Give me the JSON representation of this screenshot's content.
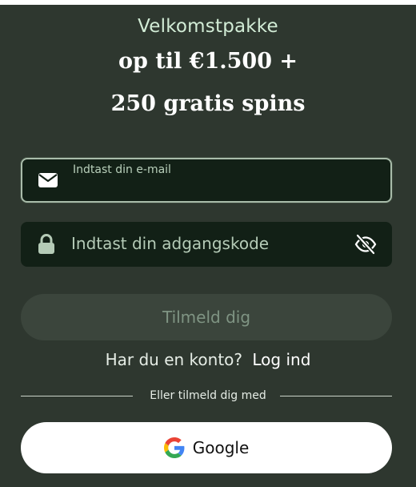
{
  "promo": {
    "subtitle": "Velkomstpakke",
    "headline_line1": "op til €1.500 +",
    "headline_line2": "250 gratis spins"
  },
  "form": {
    "email": {
      "label": "Indtast din e-mail",
      "value": "",
      "icon": "envelope-icon"
    },
    "password": {
      "placeholder": "Indtast din adgangskode",
      "value": "",
      "icon": "lock-icon",
      "toggle_icon": "eye-slash-icon"
    },
    "signup_label": "Tilmeld dig"
  },
  "login": {
    "prompt": "Har du en konto?",
    "link_label": "Log ind"
  },
  "social": {
    "divider_text": "Eller tilmeld dig med",
    "google_label": "Google",
    "google_icon": "google-logo-icon"
  },
  "colors": {
    "background": "#2e372f",
    "field_background": "#122016",
    "signup_disabled": "#3b453c",
    "accent_text": "#d2ecd6"
  }
}
